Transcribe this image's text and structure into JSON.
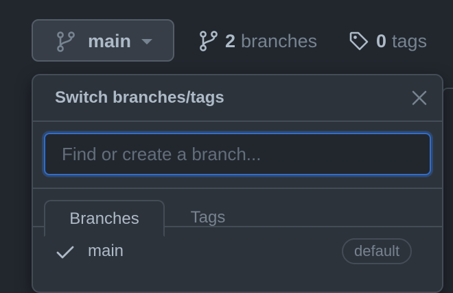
{
  "toolbar": {
    "current_branch": "main",
    "branch_icon": "git-branch-icon",
    "caret_icon": "triangle-down-icon",
    "branches_count": "2",
    "branches_label": "branches",
    "tags_count": "0",
    "tags_label": "tags",
    "tag_icon": "tag-icon"
  },
  "dropdown": {
    "title": "Switch branches/tags",
    "close_icon": "close-icon",
    "filter": {
      "placeholder": "Find or create a branch...",
      "value": ""
    },
    "tabs": [
      {
        "label": "Branches",
        "selected": true
      },
      {
        "label": "Tags",
        "selected": false
      }
    ],
    "branches": [
      {
        "name": "main",
        "checked": true,
        "badge": "default"
      }
    ]
  },
  "colors": {
    "background": "#22272e",
    "panel": "#2d333b",
    "border": "#444c56",
    "focus": "#316dca",
    "text": "#adbac7",
    "muted": "#768390"
  }
}
